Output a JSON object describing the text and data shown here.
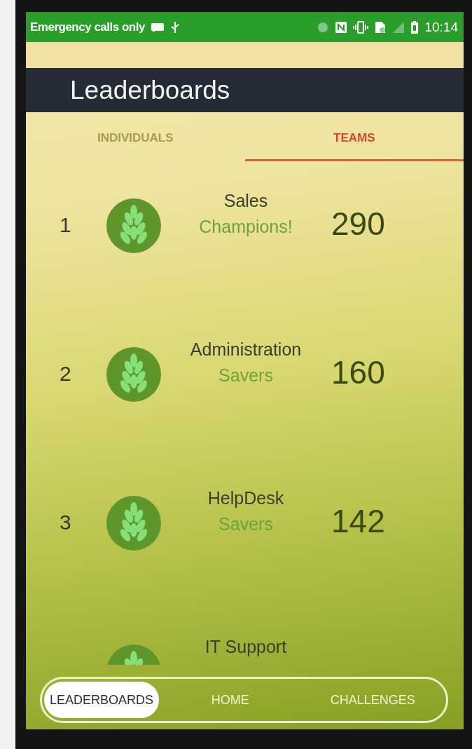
{
  "status_bar": {
    "carrier": "Emergency calls only",
    "time": "10:14"
  },
  "title": "Leaderboards",
  "tabs": [
    {
      "label": "INDIVIDUALS",
      "selected": false
    },
    {
      "label": "TEAMS",
      "selected": true
    }
  ],
  "teams": [
    {
      "rank": "1",
      "name": "Sales",
      "level_name": "Champions!",
      "score": "290"
    },
    {
      "rank": "2",
      "name": "Administration",
      "level_name": "Savers",
      "score": "160"
    },
    {
      "rank": "3",
      "name": "HelpDesk",
      "level_name": "Savers",
      "score": "142"
    },
    {
      "name": "IT Support"
    }
  ],
  "bottom_nav": [
    {
      "label": "LEADERBOARDS",
      "selected": true
    },
    {
      "label": "HOME",
      "selected": false
    },
    {
      "label": "CHALLENGES",
      "selected": false
    }
  ]
}
